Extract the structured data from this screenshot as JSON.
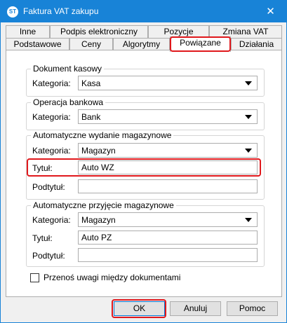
{
  "window": {
    "title": "Faktura VAT zakupu",
    "app_icon_text": "ST",
    "close_glyph": "✕",
    "accent_color": "#1883d7",
    "highlight_color": "#e0181c"
  },
  "tabs": {
    "row1": [
      {
        "label": "Inne"
      },
      {
        "label": "Podpis elektroniczny"
      },
      {
        "label": "Pozycje"
      },
      {
        "label": "Zmiana VAT"
      }
    ],
    "row2": [
      {
        "label": "Podstawowe"
      },
      {
        "label": "Ceny"
      },
      {
        "label": "Algorytmy"
      },
      {
        "label": "Powiązane",
        "active": true
      },
      {
        "label": "Działania"
      }
    ]
  },
  "groups": {
    "dokument_kasowy": {
      "title": "Dokument kasowy",
      "kategoria_label": "Kategoria:",
      "kategoria_value": "Kasa"
    },
    "operacja_bankowa": {
      "title": "Operacja bankowa",
      "kategoria_label": "Kategoria:",
      "kategoria_value": "Bank"
    },
    "wydanie": {
      "title": "Automatyczne wydanie magazynowe",
      "kategoria_label": "Kategoria:",
      "kategoria_value": "Magazyn",
      "tytul_label": "Tytuł:",
      "tytul_value": "Auto WZ",
      "podtytul_label": "Podtytuł:",
      "podtytul_value": ""
    },
    "przyjecie": {
      "title": "Automatyczne przyjęcie magazynowe",
      "kategoria_label": "Kategoria:",
      "kategoria_value": "Magazyn",
      "tytul_label": "Tytuł:",
      "tytul_value": "Auto PZ",
      "podtytul_label": "Podtytuł:",
      "podtytul_value": ""
    }
  },
  "checkbox": {
    "label": "Przenoś uwagi między dokumentami",
    "checked": false
  },
  "buttons": {
    "ok": "OK",
    "cancel": "Anuluj",
    "help": "Pomoc"
  }
}
